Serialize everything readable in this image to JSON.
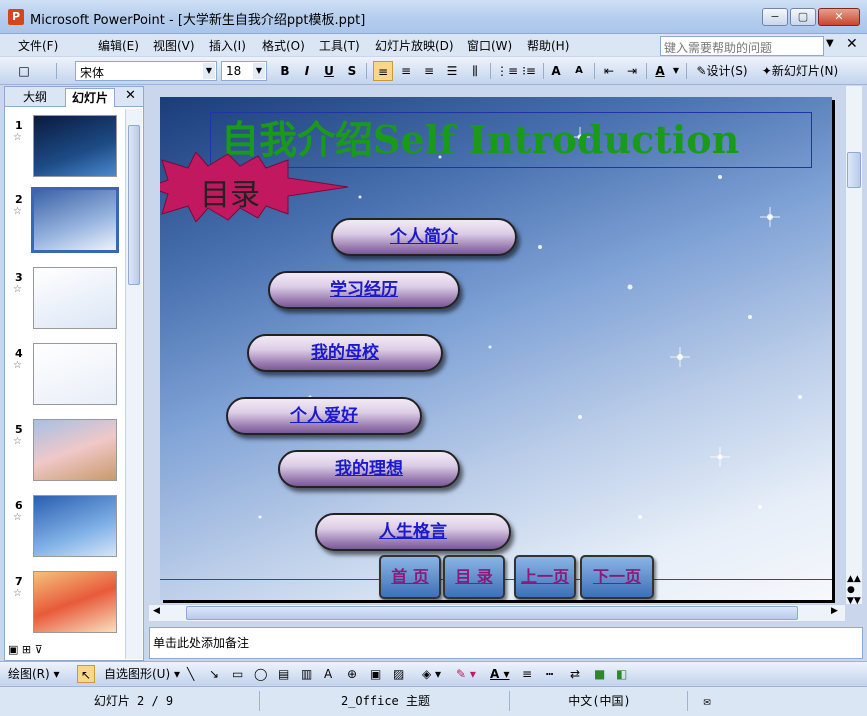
{
  "window": {
    "title": "Microsoft PowerPoint - [大学新生自我介绍ppt模板.ppt]",
    "icon": "powerpoint-icon",
    "minimize": "−",
    "maximize": "▢",
    "close": "✕"
  },
  "menubar": {
    "items": [
      "文件(F)",
      "编辑(E)",
      "视图(V)",
      "插入(I)",
      "格式(O)",
      "工具(T)",
      "幻灯片放映(D)",
      "窗口(W)",
      "帮助(H)"
    ],
    "help_placeholder": "键入需要帮助的问题",
    "doc_close": "✕"
  },
  "toolbar": {
    "font_name": "宋体",
    "font_size": "18",
    "bold": "B",
    "italic": "I",
    "underline": "U",
    "shadow": "S",
    "grow_font": "A",
    "shrink_font": "A",
    "font_color": "A",
    "design": "设计(S)",
    "new_slide": "新幻灯片(N)"
  },
  "left_pane": {
    "tabs": [
      "大纲",
      "幻灯片"
    ],
    "close": "✕",
    "slide_numbers": [
      "1",
      "2",
      "3",
      "4",
      "5",
      "6",
      "7"
    ],
    "selected_slide": 2
  },
  "slide": {
    "title": "自我介绍Self Introduction",
    "toc_label": "目录",
    "toc_items": [
      "个人简介",
      "学习经历",
      "我的母校",
      "个人爱好",
      "我的理想",
      "人生格言"
    ],
    "nav_buttons": [
      "首 页",
      "目 录",
      "上一页",
      "下一页"
    ]
  },
  "notes": {
    "placeholder": "单击此处添加备注"
  },
  "drawbar": {
    "draw": "绘图(R)",
    "autoshapes": "自选图形(U)"
  },
  "statusbar": {
    "slide_pos": "幻灯片 2 / 9",
    "theme": "2_Office 主题",
    "language": "中文(中国)"
  },
  "colors": {
    "title_green": "#1a9a1a",
    "toc_star": "#c21860",
    "link_blue": "#1a1acc",
    "nav_text": "#8a1a7a"
  }
}
